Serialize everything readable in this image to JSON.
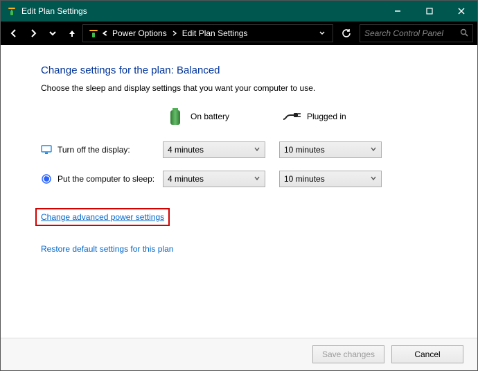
{
  "window": {
    "title": "Edit Plan Settings"
  },
  "nav": {
    "back_label": "Back",
    "forward_label": "Forward",
    "recent_label": "Recent locations",
    "up_label": "Up"
  },
  "breadcrumbs": {
    "item1": "Power Options",
    "item2": "Edit Plan Settings"
  },
  "search": {
    "placeholder": "Search Control Panel"
  },
  "page": {
    "heading": "Change settings for the plan: Balanced",
    "instruction": "Choose the sleep and display settings that you want your computer to use.",
    "state_battery": "On battery",
    "state_plugged": "Plugged in",
    "row_display_label": "Turn off the display:",
    "row_sleep_label": "Put the computer to sleep:",
    "display_battery_value": "4 minutes",
    "display_plugged_value": "10 minutes",
    "sleep_battery_value": "4 minutes",
    "sleep_plugged_value": "10 minutes",
    "link_advanced": "Change advanced power settings",
    "link_restore": "Restore default settings for this plan"
  },
  "buttons": {
    "save": "Save changes",
    "cancel": "Cancel"
  }
}
